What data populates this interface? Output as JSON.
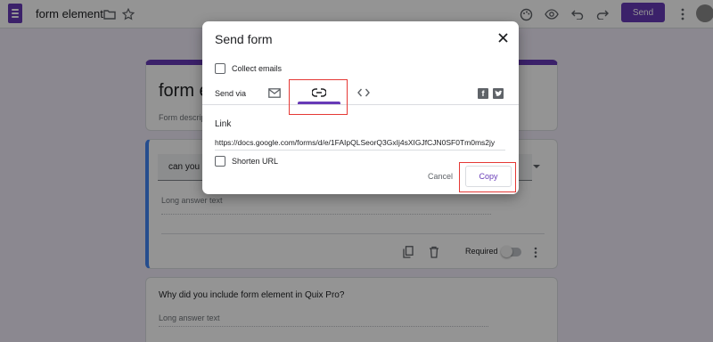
{
  "topbar": {
    "title": "form element",
    "send_label": "Send",
    "icons": [
      "forms-logo-icon",
      "folder-icon",
      "star-icon",
      "palette-icon",
      "eye-preview-icon",
      "undo-icon",
      "redo-icon",
      "more-vert-icon",
      "avatar"
    ]
  },
  "form": {
    "title_partial": "form e",
    "description_partial": "Form descrip",
    "q1_partial": "can you li",
    "long_answer": "Long answer text",
    "required_label": "Required",
    "q2_text": "Why did you include form element in Quix Pro?",
    "q2_long_answer": "Long answer text"
  },
  "dialog": {
    "title": "Send form",
    "collect_emails": "Collect emails",
    "send_via": "Send via",
    "send_via_tabs": [
      "email-icon",
      "link-icon",
      "embed-code-icon"
    ],
    "active_tab": "link",
    "social": [
      "facebook-icon",
      "twitter-icon"
    ],
    "link_label": "Link",
    "link_url": "https://docs.google.com/forms/d/e/1FAIpQLSeorQ3GxIj4sXIGJfCJN0SF0Tm0ms2jy",
    "shorten_url": "Shorten URL",
    "cancel_label": "Cancel",
    "copy_label": "Copy"
  },
  "colors": {
    "brand": "#673ab7",
    "highlight": "#e53935"
  }
}
